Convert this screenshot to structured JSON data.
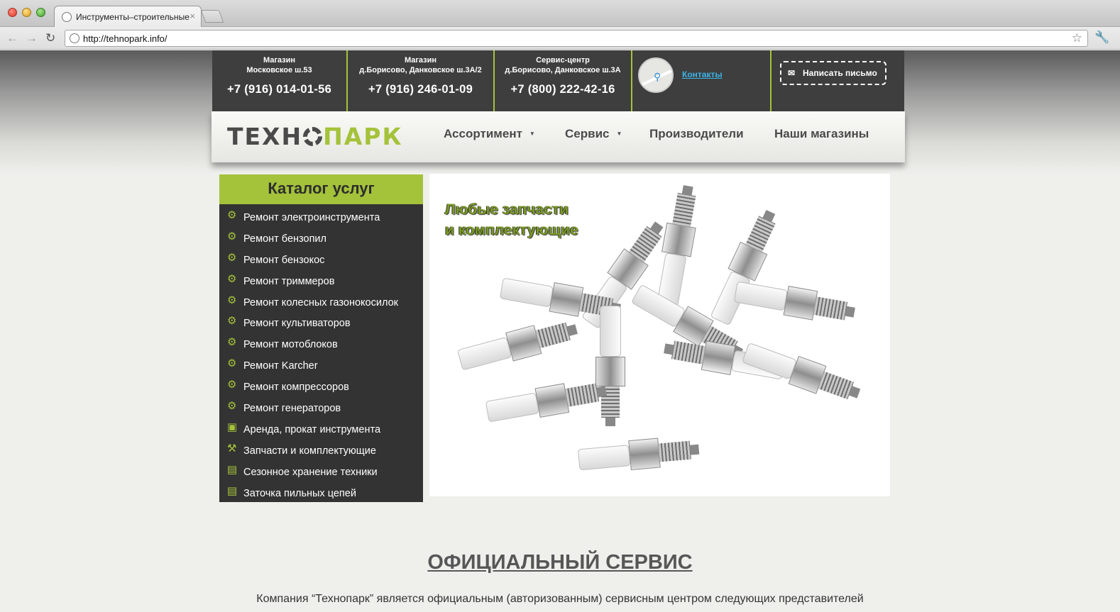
{
  "browser": {
    "tab_title": "Инструменты–строительные",
    "tab_close": "×",
    "url": "http://tehnopark.info/"
  },
  "header": {
    "stores": [
      {
        "title_line1": "Магазин",
        "title_line2": "Московское ш.53",
        "phone": "+7 (916) 014-01-56"
      },
      {
        "title_line1": "Магазин",
        "title_line2": "д.Борисово, Данковское ш.3А/2",
        "phone": "+7 (916) 246-01-09"
      },
      {
        "title_line1": "Сервис-центр",
        "title_line2": "д.Борисово, Данковское ш.3А",
        "phone": "+7 (800) 222-42-16"
      }
    ],
    "contacts_link": "Контакты",
    "write_button": "Написать письмо"
  },
  "logo": {
    "part1": "ТЕХН",
    "part2": "ПАРК"
  },
  "nav": {
    "items": [
      {
        "label": "Ассортимент",
        "has_dropdown": true
      },
      {
        "label": "Сервис",
        "has_dropdown": true
      },
      {
        "label": "Производители",
        "has_dropdown": false
      },
      {
        "label": "Наши магазины",
        "has_dropdown": false
      }
    ]
  },
  "catalog": {
    "title": "Каталог услуг",
    "items": [
      {
        "label": "Ремонт электроинструмента",
        "icon": "gear-icon"
      },
      {
        "label": "Ремонт бензопил",
        "icon": "gear-icon"
      },
      {
        "label": "Ремонт бензокос",
        "icon": "gear-icon"
      },
      {
        "label": "Ремонт триммеров",
        "icon": "gear-icon"
      },
      {
        "label": "Ремонт колесных газонокосилок",
        "icon": "gear-icon"
      },
      {
        "label": "Ремонт культиваторов",
        "icon": "gear-icon"
      },
      {
        "label": "Ремонт мотоблоков",
        "icon": "gear-icon"
      },
      {
        "label": "Ремонт Karcher",
        "icon": "gear-icon"
      },
      {
        "label": "Ремонт компрессоров",
        "icon": "gear-icon"
      },
      {
        "label": "Ремонт генераторов",
        "icon": "gear-icon"
      },
      {
        "label": "Аренда, прокат инструмента",
        "icon": "toolbox-icon"
      },
      {
        "label": "Запчасти и комплектующие",
        "icon": "parts-icon"
      },
      {
        "label": "Сезонное хранение техники",
        "icon": "lock-icon"
      },
      {
        "label": "Заточка пильных цепей",
        "icon": "lock-icon"
      }
    ]
  },
  "banner": {
    "line1": "Любые запчасти",
    "line2": "и комплектующие"
  },
  "official": {
    "title": "ОФИЦИАЛЬНЫЙ СЕРВИС",
    "text": "Компания “Технопарк” является официальным (авторизованным) сервисным центром следующих представителей"
  },
  "colors": {
    "accent": "#a4c23a",
    "dark": "#333333",
    "link": "#3db4e8"
  }
}
